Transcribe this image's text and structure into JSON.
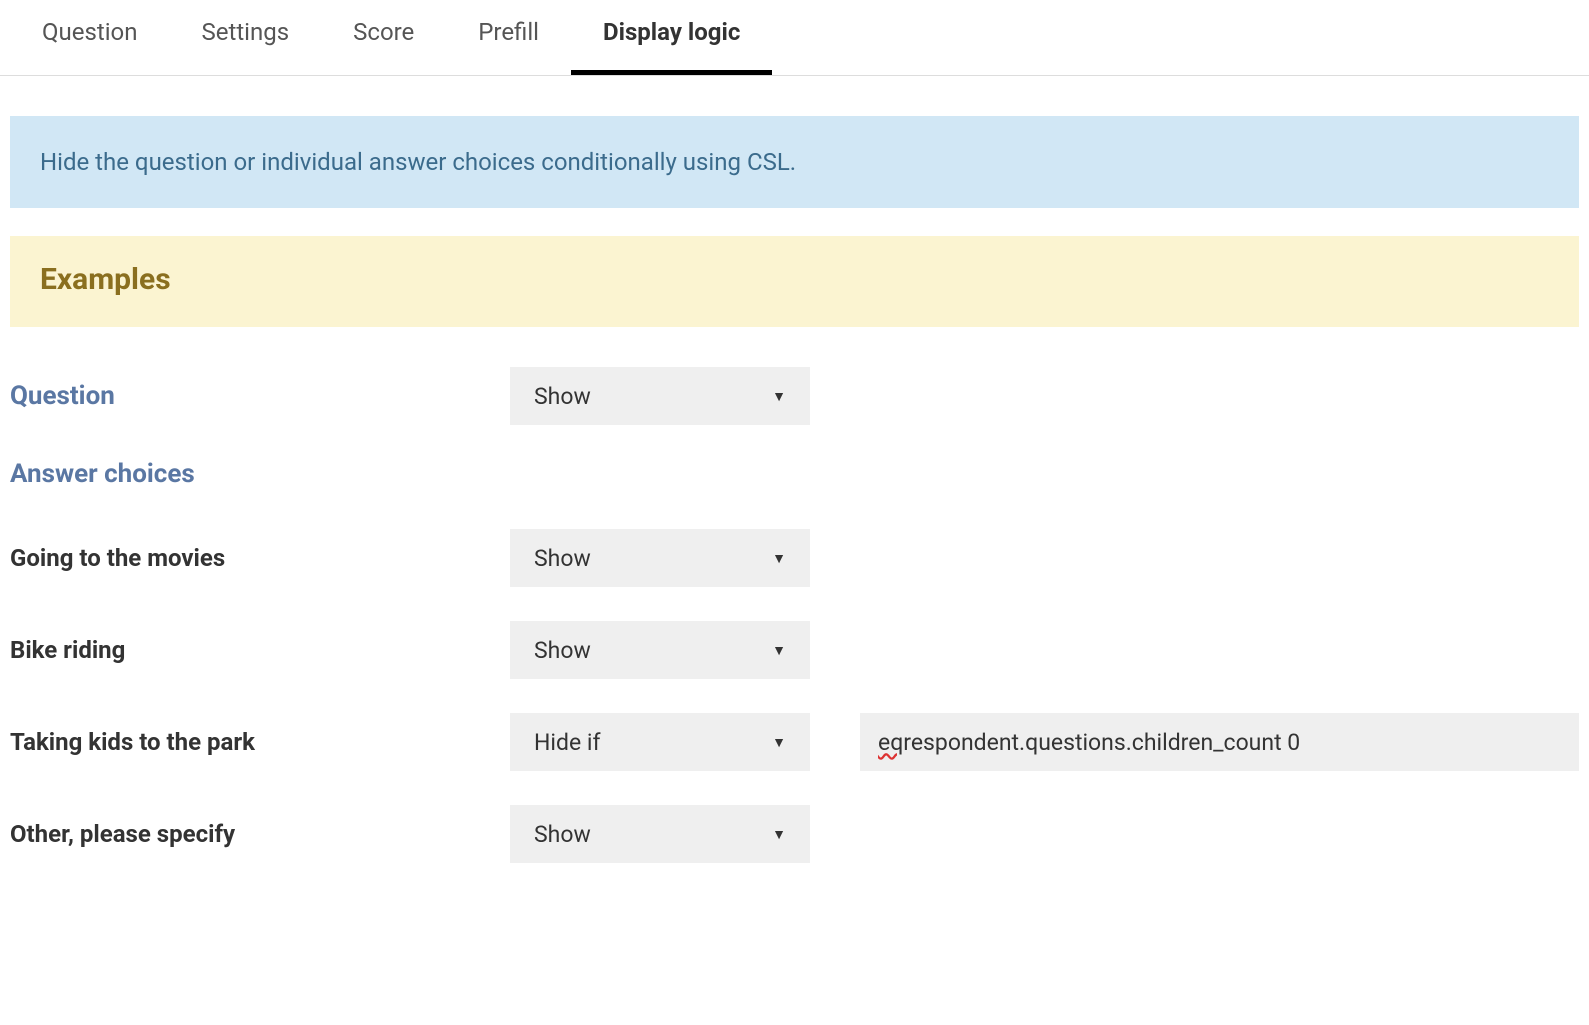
{
  "tabs": {
    "question": "Question",
    "settings": "Settings",
    "score": "Score",
    "prefill": "Prefill",
    "display_logic": "Display logic"
  },
  "info_text": "Hide the question or individual answer choices conditionally using CSL.",
  "examples_heading": "Examples",
  "question_section": {
    "label": "Question",
    "select_value": "Show"
  },
  "answer_choices_heading": "Answer choices",
  "answers": [
    {
      "label": "Going to the movies",
      "select_value": "Show",
      "condition": ""
    },
    {
      "label": "Bike riding",
      "select_value": "Show",
      "condition": ""
    },
    {
      "label": "Taking kids to the park",
      "select_value": "Hide if",
      "condition_prefix": "eq",
      "condition_rest": " respondent.questions.children_count 0"
    },
    {
      "label": "Other, please specify",
      "select_value": "Show",
      "condition": ""
    }
  ]
}
